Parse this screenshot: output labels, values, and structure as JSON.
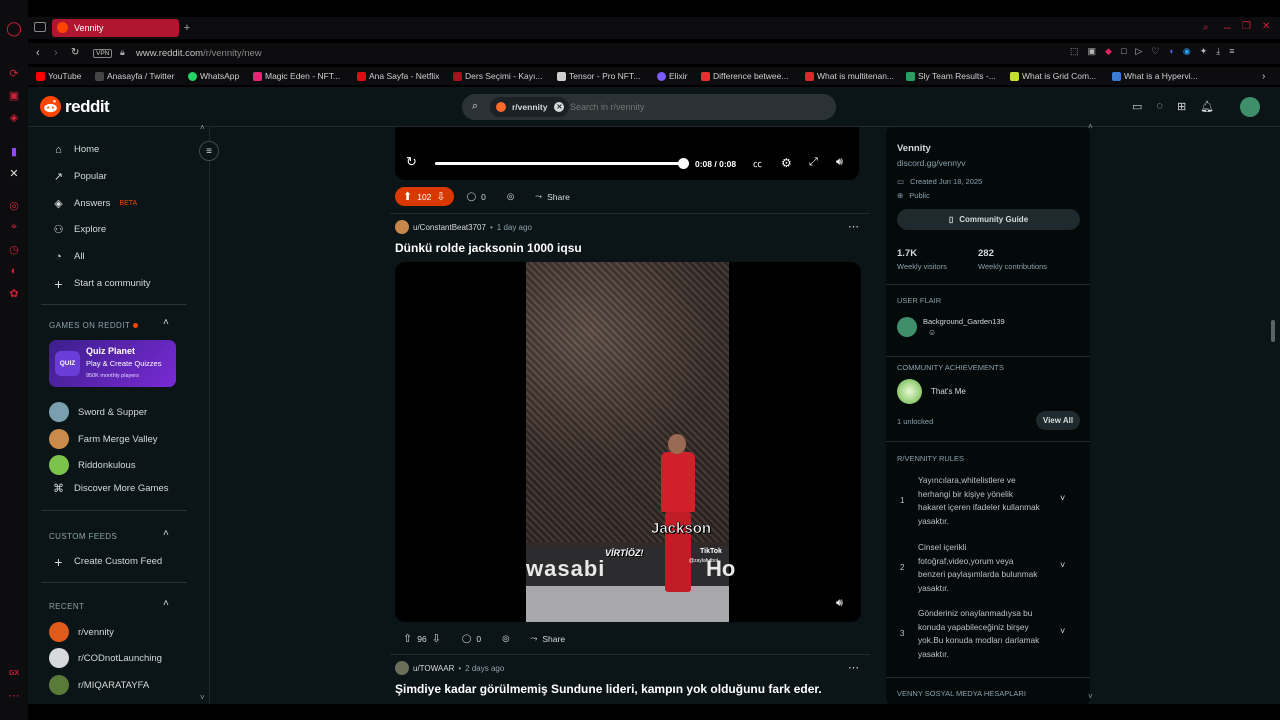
{
  "browser": {
    "tab_title": "Vennity",
    "url_host": "www.reddit.com",
    "url_path": "/r/vennity/new",
    "vpn_label": "VPN",
    "bookmarks": [
      {
        "label": "YouTube",
        "color": "#ff0000"
      },
      {
        "label": "Anasayfa / Twitter",
        "color": "#e0e0e0"
      },
      {
        "label": "WhatsApp",
        "color": "#25d366"
      },
      {
        "label": "Magic Eden - NFT...",
        "color": "#e42575"
      },
      {
        "label": "Ana Sayfa - Netflix",
        "color": "#e50914"
      },
      {
        "label": "Ders Seçimi - Kayı...",
        "color": "#a0141e"
      },
      {
        "label": "Tensor - Pro NFT...",
        "color": "#cfcfcf"
      },
      {
        "label": "Elixir",
        "color": "#7b5cff"
      },
      {
        "label": "Difference betwee...",
        "color": "#e03030"
      },
      {
        "label": "What is multitenan...",
        "color": "#d42c2c"
      },
      {
        "label": "Sly Team Results -...",
        "color": "#21a366"
      },
      {
        "label": "What is Grid Com...",
        "color": "#c6e02a"
      },
      {
        "label": "What is a Hypervi...",
        "color": "#3a7bd5"
      }
    ]
  },
  "header": {
    "logo_text": "reddit",
    "search_chip": "r/vennity",
    "search_placeholder": "Search in r/vennity"
  },
  "nav": {
    "items": [
      "Home",
      "Popular",
      "Answers",
      "Explore",
      "All",
      "Start a community"
    ],
    "answers_badge": "BETA",
    "games_title": "GAMES ON REDDIT",
    "quiz": {
      "title": "Quiz Planet",
      "subtitle": "Play & Create Quizzes",
      "meta": "950K monthly players",
      "icon_text": "QUIZ"
    },
    "games": [
      "Sword & Supper",
      "Farm Merge Valley",
      "Riddonkulous",
      "Discover More Games"
    ],
    "custom_feeds_title": "CUSTOM FEEDS",
    "create_custom_feed": "Create Custom Feed",
    "recent_title": "RECENT",
    "recent": [
      "r/vennity",
      "r/CODnotLaunching",
      "r/MIQARATAYFA"
    ]
  },
  "video_player": {
    "time": "0:08 / 0:08",
    "progress": 1.0
  },
  "posts": [
    {
      "upvotes": "102",
      "comments": "0",
      "share": "Share"
    },
    {
      "author": "u/ConstantBeat3707",
      "time": "1 day ago",
      "title": "Dünkü rolde jacksonin 1000 iqsu",
      "overlay_name": "Jackson",
      "overlay_tag": "VİRTİÖZ!",
      "overlay_tiktok": "TikTok",
      "overlay_handle": "@zaylafutbol",
      "board_text": "wasabi",
      "board_text2": "Ho",
      "upvotes": "96",
      "comments": "0",
      "share": "Share"
    },
    {
      "author": "u/TOWAAR",
      "time": "2 days ago",
      "title": "Şimdiye kadar görülmemiş Sundune lideri, kampın yok olduğunu fark eder."
    }
  ],
  "sidebar": {
    "name": "Vennity",
    "link": "discord.gg/vennyv",
    "created": "Created Jun 18, 2025",
    "visibility": "Public",
    "guide_button": "Community Guide",
    "visitors": "1.7K",
    "visitors_label": "Weekly visitors",
    "contributions": "282",
    "contributions_label": "Weekly contributions",
    "user_flair_title": "USER FLAIR",
    "flair_user": "Background_Garden139",
    "achievements_title": "COMMUNITY ACHIEVEMENTS",
    "achievement": "That's Me",
    "unlocked": "1 unlocked",
    "view_all": "View All",
    "rules_title": "R/VENNITY RULES",
    "rules": [
      "Yayıncılara,whitelistlere ve herhangi bir kişiye yönelik hakaret içeren ifadeler kullanmak yasaktır.",
      "Cinsel içerikli fotoğraf,video,yorum veya benzeri paylaşımlarda bulunmak yasaktır.",
      "Gönderiniz onaylanmadıysa bu konuda yapabileceğiniz birşey yok.Bu konuda modları darlamak yasaktır."
    ],
    "socials_title": "VENNY SOSYAL MEDYA HESAPLARI"
  },
  "colors": {
    "accent": "#d93900",
    "brand": "#ff4500",
    "opera": "#d0213a",
    "bg": "#0b1416"
  }
}
